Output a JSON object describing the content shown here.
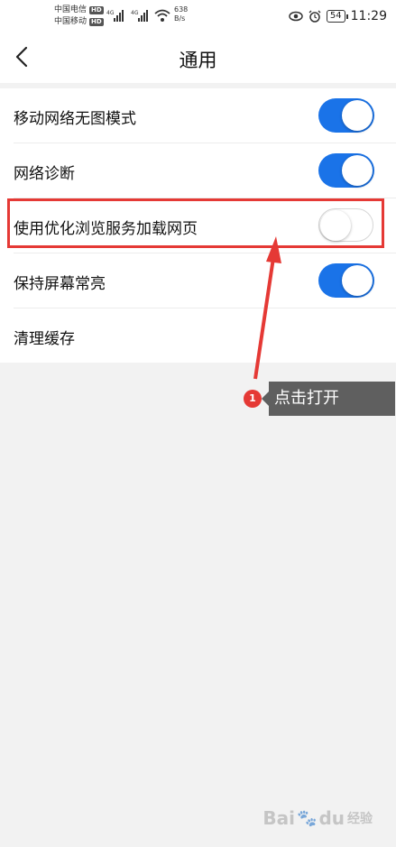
{
  "status_bar": {
    "carrier_1": "中国电信",
    "carrier_2": "中国移动",
    "hd_badge": "HD",
    "network_type": "4G",
    "speed_value": "638",
    "speed_unit": "B/s",
    "battery": "54",
    "time": "11:29"
  },
  "nav": {
    "back_icon": "chevron-left-icon",
    "title": "通用"
  },
  "settings": [
    {
      "label": "移动网络无图模式",
      "toggle": true
    },
    {
      "label": "网络诊断",
      "toggle": true
    },
    {
      "label": "使用优化浏览服务加载网页",
      "toggle": false
    },
    {
      "label": "保持屏幕常亮",
      "toggle": true
    },
    {
      "label": "清理缓存"
    }
  ],
  "annotation": {
    "step_number": "1",
    "text": "点击打开"
  },
  "watermark": {
    "brand": "Bai",
    "brand_suffix": "du",
    "cn": "经验"
  },
  "colors": {
    "toggle_on": "#1a73e8",
    "highlight": "#e53935",
    "tooltip_bg": "#5f5f5f"
  }
}
